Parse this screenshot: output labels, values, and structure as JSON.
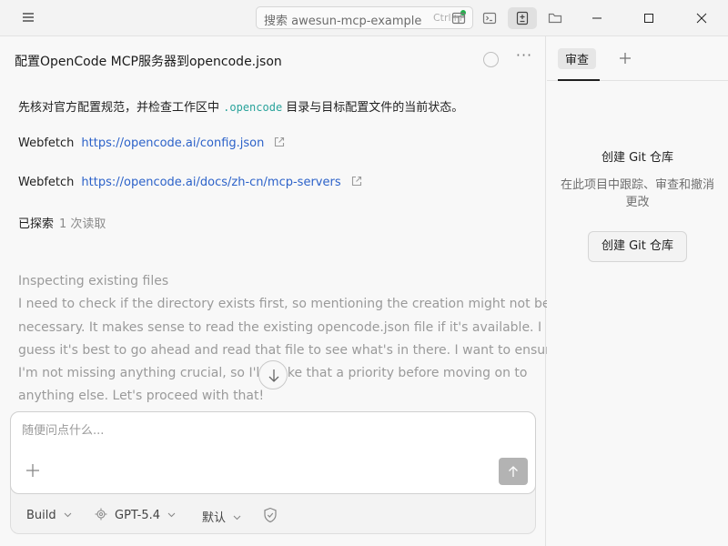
{
  "titlebar": {
    "search_label": "搜索 awesun-mcp-example",
    "search_shortcut": "Ctrl+P"
  },
  "session": {
    "title": "配置OpenCode MCP服务器到opencode.json",
    "more_label": "···"
  },
  "messages": {
    "intro_before": "先核对官方配置规范，并检查工作区中 ",
    "intro_code": ".opencode",
    "intro_after": " 目录与目标配置文件的当前状态。",
    "webfetch": [
      {
        "label": "Webfetch",
        "url": "https://opencode.ai/config.json"
      },
      {
        "label": "Webfetch",
        "url": "https://opencode.ai/docs/zh-cn/mcp-servers"
      }
    ],
    "explored_label": "已探索",
    "explored_count": "1 次读取"
  },
  "reasoning": {
    "title": "Inspecting existing files",
    "lines": [
      "I need to check if the directory exists first, so mentioning the creation might not be",
      "necessary. It makes sense to read the existing opencode.json file if it's available. I",
      "guess it's best to go ahead and read that file to see what's in there. I want to ensure",
      "I'm not missing anything crucial, so I'll make that a priority before moving on to",
      "anything else. Let's proceed with that!"
    ]
  },
  "composer": {
    "placeholder": "随便问点什么...",
    "agent": "Build",
    "model": "GPT-5.4",
    "variant": "默认"
  },
  "side": {
    "tab_review": "审查",
    "git_title": "创建 Git 仓库",
    "git_desc": "在此项目中跟踪、审查和撤消更改",
    "git_button": "创建 Git 仓库"
  },
  "colors": {
    "link": "#2c62c9",
    "code": "#2aa39b",
    "status_dot": "#22b14c"
  }
}
